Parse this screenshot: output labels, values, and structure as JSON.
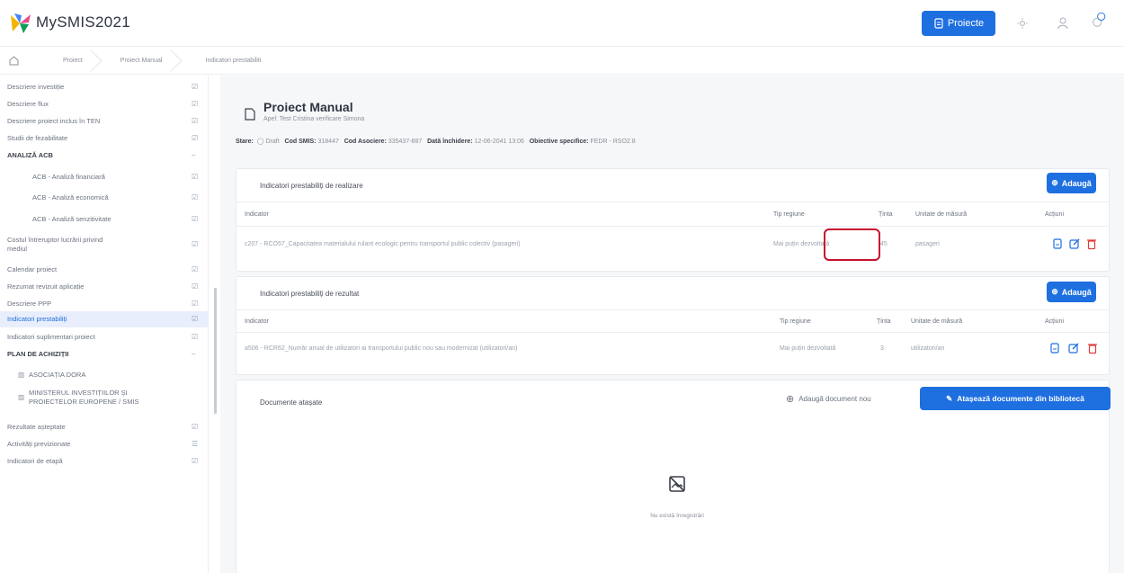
{
  "app": {
    "title": "MySMIS2021",
    "project_button": "Proiecte"
  },
  "breadcrumb": [
    "Proiect",
    "Proiect Manual",
    "Indicatori prestabiliti"
  ],
  "sidebar": {
    "items": [
      {
        "label": "Descriere investiție",
        "kind": "item"
      },
      {
        "label": "Descriere flux",
        "kind": "item"
      },
      {
        "label": "Descriere proiect inclus în TEN",
        "kind": "item"
      },
      {
        "label": "Studii de fezabilitate",
        "kind": "item"
      },
      {
        "label": "ANALIZĂ ACB",
        "kind": "header"
      },
      {
        "label": "ACB - Analiză financiară",
        "kind": "sub"
      },
      {
        "label": "ACB - Analiză economică",
        "kind": "sub"
      },
      {
        "label": "ACB - Analiză senzitivitate",
        "kind": "sub"
      },
      {
        "label": "Costul întreruptor lucrării privind",
        "label2": "mediul",
        "kind": "item"
      },
      {
        "label": "Calendar proiect",
        "kind": "item"
      },
      {
        "label": "Rezumat revizuit aplicație",
        "kind": "item"
      },
      {
        "label": "Descriere PPP",
        "kind": "item"
      },
      {
        "label": "Indicatori prestabiliți",
        "kind": "active"
      },
      {
        "label": "Indicatori suplimentari proiect",
        "kind": "item"
      },
      {
        "label": "PLAN DE ACHIZIȚII",
        "kind": "header"
      },
      {
        "label": "ASOCIAȚIA DORA",
        "kind": "org"
      },
      {
        "label": "MINISTERUL INVESTIȚIILOR ȘI",
        "label2": "PROIECTELOR EUROPENE / SMIS",
        "kind": "org"
      },
      {
        "label": "Rezultate așteptate",
        "kind": "item"
      },
      {
        "label": "Activități previzionate",
        "kind": "item"
      },
      {
        "label": "Indicatori de etapă",
        "kind": "item"
      }
    ]
  },
  "page": {
    "title": "Proiect Manual",
    "subtitle": "Apel: Test Cristina verificare Simona",
    "meta": {
      "stare_label": "Stare:",
      "stare_value": "Draft",
      "cod_smis_label": "Cod SMIS:",
      "cod_smis_value": "318447",
      "cod_asociere_label": "Cod Asociere:",
      "cod_asociere_value": "335437-887",
      "data_label": "Dată închidere:",
      "data_value": "12-06-2041 13:06",
      "obiectiv_label": "Obiective specifice:",
      "obiectiv_value": "FEDR - RSO2.8"
    }
  },
  "realizare": {
    "title": "Indicatori prestabiliți de realizare",
    "add_label": "Adaugă",
    "headers": [
      "Indicator",
      "Tip regiune",
      "Ținta",
      "Unitate de măsură",
      "Acțiuni"
    ],
    "rows": [
      [
        "c207 - RCO57_Capacitatea materialului rulant ecologic pentru transportul public colectiv (pasageri)",
        "Mai puțin dezvoltată",
        "45",
        "pasageri"
      ]
    ]
  },
  "rezultat": {
    "title": "Indicatori prestabiliți de rezultat",
    "add_label": "Adaugă",
    "headers": [
      "Indicator",
      "Tip regiune",
      "Ținta",
      "Unitate de măsură",
      "Acțiuni"
    ],
    "rows": [
      [
        "a506 - RCR62_Număr anual de utilizatori ai transportului public nou sau modernizat (utilizatori/an)",
        "Mai puțin dezvoltată",
        "3",
        "utilizatori/an"
      ]
    ]
  },
  "documente": {
    "title": "Documente atașate",
    "add_new": "Adaugă document nou",
    "attach_lib": "Atașează documente din bibliotecă",
    "empty": "Nu există înregistrări"
  },
  "colors": {
    "primary": "#1e6fe0",
    "danger": "#e23a3a",
    "highlight": "#c8102e"
  }
}
